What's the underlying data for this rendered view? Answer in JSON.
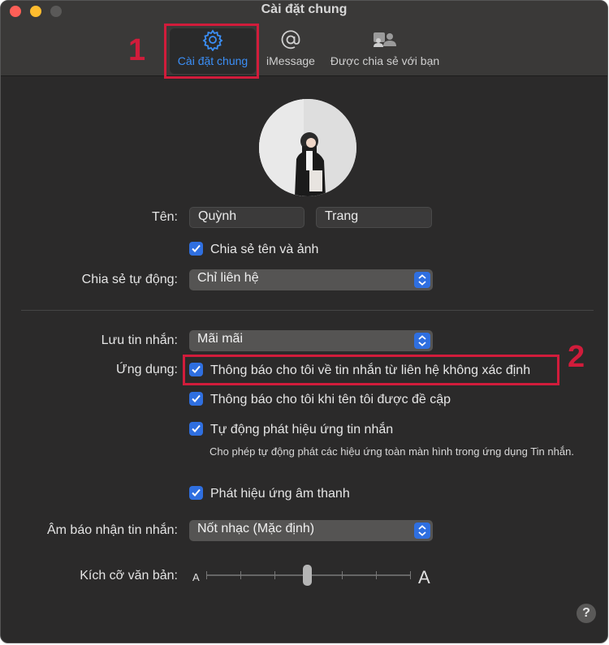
{
  "window": {
    "title": "Cài đặt chung"
  },
  "tabs": [
    {
      "label": "Cài đặt chung",
      "icon": "gear-icon",
      "selected": true
    },
    {
      "label": "iMessage",
      "icon": "at-icon"
    },
    {
      "label": "Được chia sẻ với bạn",
      "icon": "shared-with-you-icon"
    }
  ],
  "annotations": {
    "one": "1",
    "two": "2"
  },
  "profile": {
    "name_label": "Tên:",
    "first_name": "Quỳnh",
    "last_name": "Trang",
    "share_name_photo": "Chia sẻ tên và ảnh",
    "auto_share_label": "Chia sẻ tự động:",
    "auto_share_value": "Chỉ liên hệ"
  },
  "settings": {
    "keep_messages_label": "Lưu tin nhắn:",
    "keep_messages_value": "Mãi mãi",
    "application_label": "Ứng dụng:",
    "notify_unknown": "Thông báo cho tôi về tin nhắn từ liên hệ không xác định",
    "notify_mentioned": "Thông báo cho tôi khi tên tôi được đề cập",
    "auto_play_effects": "Tự động phát hiệu ứng tin nhắn",
    "auto_play_desc": "Cho phép tự động phát các hiệu ứng toàn màn hình trong ứng dụng Tin nhắn.",
    "play_sound_effects": "Phát hiệu ứng âm thanh",
    "received_sound_label": "Âm báo nhận tin nhắn:",
    "received_sound_value": "Nốt nhạc (Mặc định)",
    "text_size_label": "Kích cỡ văn bản:",
    "text_size_small": "A",
    "text_size_large": "A",
    "text_size_level": 0.5
  },
  "help": "?",
  "colors": {
    "accent": "#2f6fe0",
    "annotation": "#d11c3b",
    "tab_selected": "#3b8ff7"
  }
}
